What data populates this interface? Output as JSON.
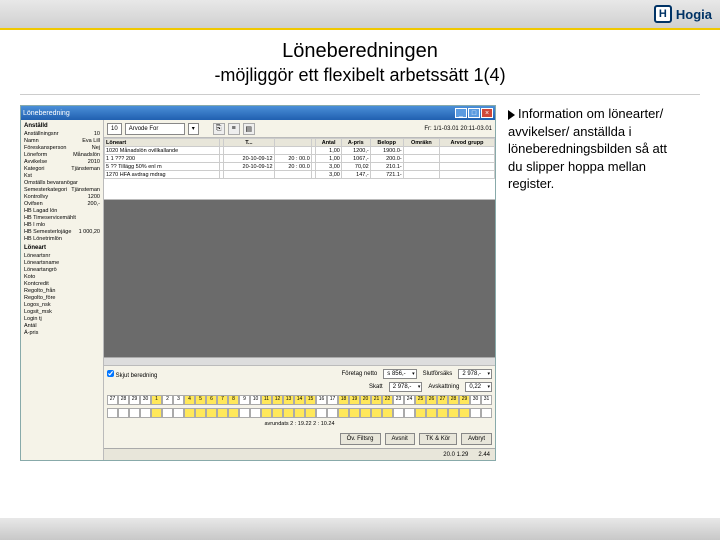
{
  "brand": "Hogia",
  "title": "Löneberedningen",
  "subtitle": "-möjliggör ett flexibelt arbetssätt 1(4)",
  "caption": "Information om lönearter/ avvikelser/ anställda i löneberedningsbilden så att du slipper hoppa mellan register.",
  "win": {
    "title": "Löneberedning",
    "min": "_",
    "max": "□",
    "close": "×"
  },
  "sidebar": {
    "hdr1": "Anställd",
    "rows1": [
      [
        "Anställningsnr",
        "10"
      ],
      [
        "Namn",
        "Eva Lill"
      ],
      [
        "Föreskansperson",
        "Nej"
      ],
      [
        "Löneform",
        "Månadslön"
      ],
      [
        "Avvikelse",
        "2010"
      ],
      [
        "Kategori",
        "Tjänsteman"
      ],
      [
        "Kst",
        ""
      ],
      [
        "Omställs bevaranögar",
        ""
      ],
      [
        "Semesterkategori",
        "Tjänsteman"
      ],
      [
        "Kontrollvy",
        "1200"
      ],
      [
        "Ovifsen",
        "200,-"
      ],
      [
        "HB Lagad lön",
        ""
      ],
      [
        "HB Timeservicemählt",
        ""
      ],
      [
        "HB I mlo",
        ""
      ],
      [
        "HB Semesterlojäge",
        "1 000,20"
      ],
      [
        "HB Lönetrimlön",
        ""
      ]
    ],
    "hdr2": "Löneart",
    "rows2": [
      [
        "Löneartsnr",
        ""
      ],
      [
        "Löneartsname",
        ""
      ],
      [
        "Löneartangrö",
        ""
      ],
      [
        "Koto",
        ""
      ],
      [
        "Kontcredit",
        ""
      ],
      [
        "Regolto_från",
        ""
      ],
      [
        "Regolto_före",
        ""
      ],
      [
        "Logos_nsk",
        ""
      ],
      [
        "Logsit_msk",
        ""
      ],
      [
        "Login tj",
        ""
      ],
      [
        "Antál",
        ""
      ],
      [
        "Á-pris",
        ""
      ]
    ]
  },
  "toolbar": {
    "sel1": "10",
    "sel2": "Arvode For",
    "datespan": "Fr: 1/1-03.01  20:11-03.01"
  },
  "grid": {
    "headers": [
      "Löneart",
      "",
      "T...",
      "",
      "",
      "Antal",
      "A-pris",
      "Belopp",
      "Omräkn",
      "Arvod grupp"
    ],
    "rows": [
      [
        "1020 Månadslön ovillkallande",
        "",
        "",
        "",
        "",
        "1,00",
        "1200,-",
        "1900.0-",
        "",
        ""
      ],
      [
        "1 1 ??? 200",
        "",
        "20-10-09-12",
        "20  : 00.0",
        "",
        "1,00",
        "1067,-",
        "200.0-",
        "",
        ""
      ],
      [
        "5 ?? Tillägg 50% enl m",
        "",
        "20-10-09-12",
        "20  : 00.0",
        "",
        "3,00",
        "70,02",
        "210.1-",
        "",
        ""
      ],
      [
        "1270 HFA avdrag mdrag",
        "",
        "",
        "",
        "",
        "3,00",
        "147,-",
        "721.1-",
        "",
        ""
      ]
    ]
  },
  "bottom": {
    "chk": "Skjut beredning",
    "lbl1": "Företag netto",
    "val1": "s 856,-",
    "lbl2": "Slutförsäks",
    "val2": "2 978,-",
    "lbl3": "Skatt",
    "val3": "2 978,-",
    "lbl4": "Avskattning",
    "val4": "0,22",
    "days": [
      "27",
      "28",
      "29",
      "30",
      "1",
      "2",
      "3",
      "4",
      "5",
      "6",
      "7",
      "8",
      "9",
      "10",
      "11",
      "12",
      "13",
      "14",
      "15",
      "16",
      "17",
      "18",
      "19",
      "20",
      "21",
      "22",
      "23",
      "24",
      "25",
      "26",
      "27",
      "28",
      "29",
      "30",
      "31"
    ],
    "schedline": "avrundats 2 : 19.22  2 : 10.24"
  },
  "buttons": {
    "b1": "Öv. Filtsrg",
    "b2": "Avsnit",
    "b3": "TK & Kör",
    "b4": "Avbryt"
  },
  "status": {
    "s1": "20.0  1.29",
    "s2": "2.44"
  }
}
